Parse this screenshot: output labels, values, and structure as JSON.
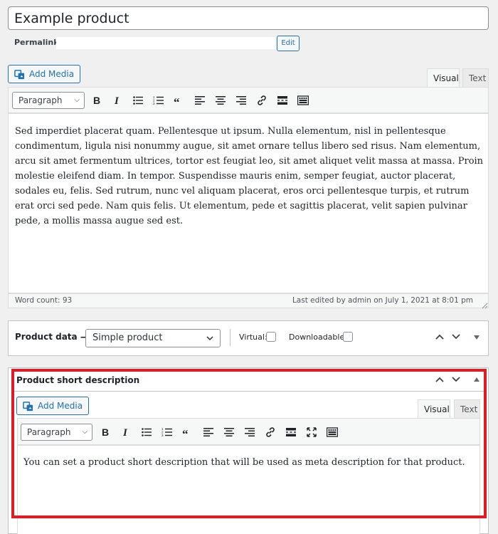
{
  "title": {
    "value": "Example product"
  },
  "permalink": {
    "label": "Permalink:",
    "edit_label": "Edit"
  },
  "main_editor": {
    "add_media_label": "Add Media",
    "tabs": [
      "Visual",
      "Text"
    ],
    "format_select": "Paragraph",
    "toolbar_icons": [
      "bold-icon",
      "italic-icon",
      "bulleted-list-icon",
      "numbered-list-icon",
      "blockquote-icon",
      "align-left-icon",
      "align-center-icon",
      "align-right-icon",
      "link-icon",
      "read-more-icon",
      "toolbar-toggle-icon"
    ],
    "content": "Sed imperdiet placerat quam. Pellentesque ut ipsum. Nulla elementum, nisl in pellentesque condimentum, ligula nisi nonummy augue, sit amet ornare tellus libero sed risus. Nam elementum, arcu sit amet fermentum ultrices, tortor est feugiat leo, sit amet aliquet velit massa at massa. Proin molestie eleifend diam. In tempor. Suspendisse mauris enim, semper feugiat, auctor placerat, sodales eu, felis. Sed rutrum, nunc vel aliquam placerat, eros orci pellentesque turpis, et rutrum erat orci sed pede. Nam quis felis. Ut elementum, pede et sagittis placerat, velit sapien pulvinar pede, a mollis massa augue sed est.",
    "word_count": "Word count: 93",
    "last_edited": "Last edited by admin on July 1, 2021 at 8:01 pm"
  },
  "product_data": {
    "label": "Product data —",
    "type_select": "Simple product",
    "virtual_label": "Virtual:",
    "downloadable_label": "Downloadable:"
  },
  "short_description": {
    "header": "Product short description",
    "add_media_label": "Add Media",
    "tabs": [
      "Visual",
      "Text"
    ],
    "format_select": "Paragraph",
    "toolbar_icons": [
      "bold-icon",
      "italic-icon",
      "bulleted-list-icon",
      "numbered-list-icon",
      "blockquote-icon",
      "align-left-icon",
      "align-center-icon",
      "align-right-icon",
      "link-icon",
      "read-more-icon",
      "fullscreen-icon",
      "toolbar-toggle-icon"
    ],
    "content": "You can set a product short description that will be used as meta description for that product."
  },
  "colors": {
    "accent": "#2271b1",
    "highlight": "#e01b24"
  }
}
